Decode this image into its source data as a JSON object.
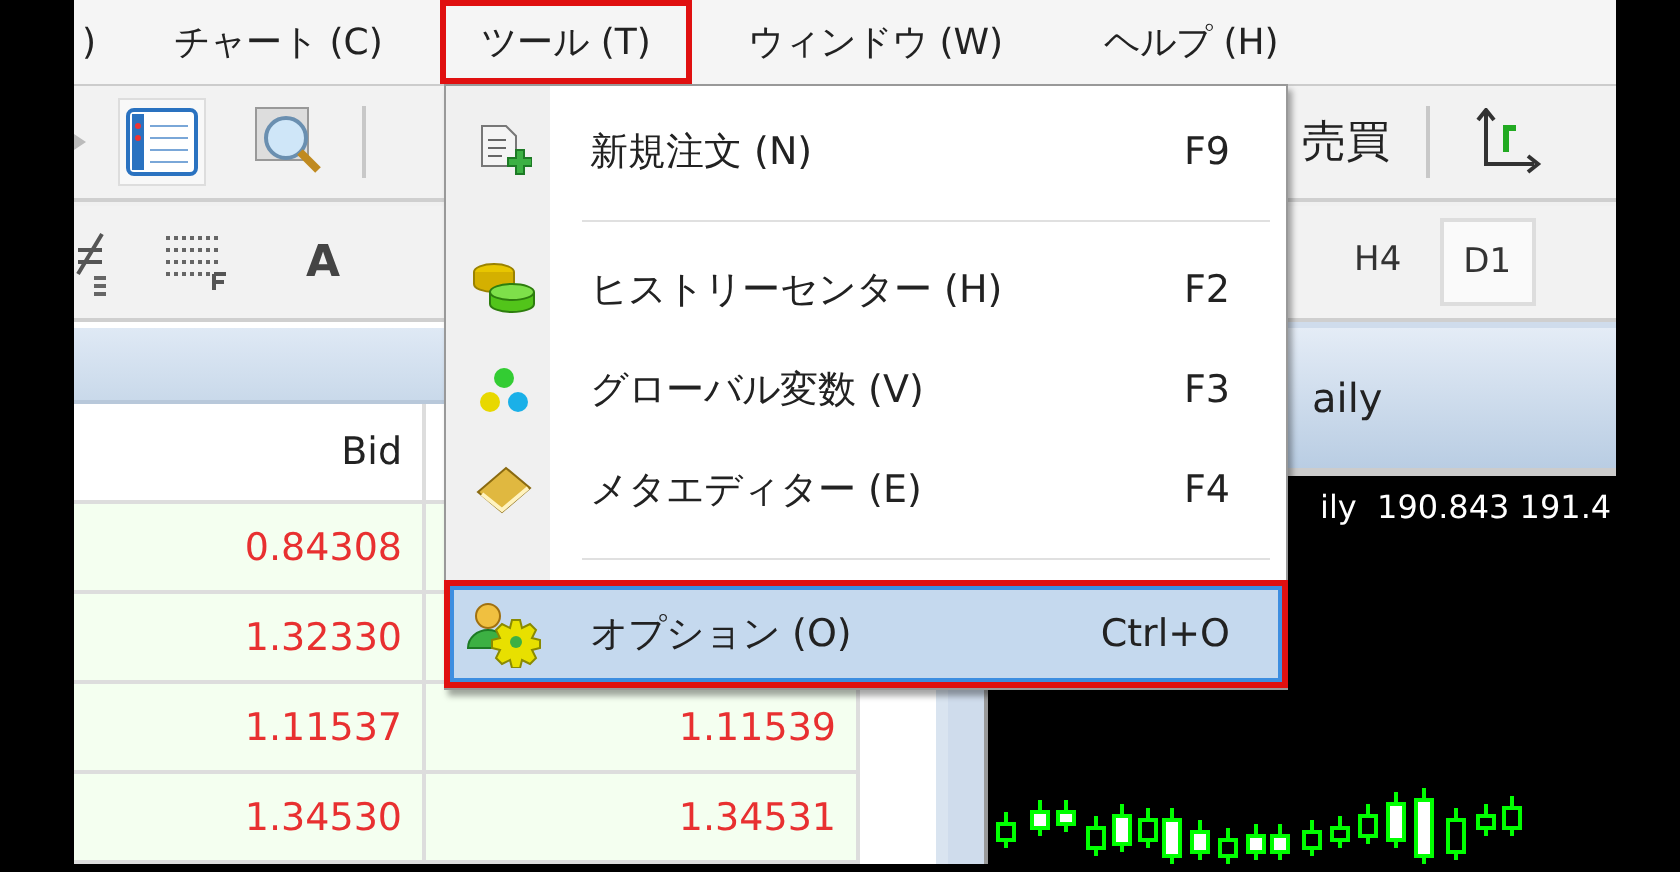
{
  "menu_bar": [
    {
      "label": ")",
      "marked": false
    },
    {
      "label": "チャート (C)",
      "marked": false
    },
    {
      "label": "ツール (T)",
      "marked": true
    },
    {
      "label": "ウィンドウ (W)",
      "marked": false
    },
    {
      "label": "ヘルプ (H)",
      "marked": false
    }
  ],
  "toolbar": {
    "trade_label": "売買",
    "font_button": "A",
    "timeframes": [
      {
        "label": "H4",
        "selected": false
      },
      {
        "label": "D1",
        "selected": true
      }
    ]
  },
  "dropdown": {
    "items": [
      {
        "kind": "item",
        "label": "新規注文 (N)",
        "shortcut": "F9",
        "selected": false,
        "marked": false
      },
      {
        "kind": "separator"
      },
      {
        "kind": "item",
        "label": "ヒストリーセンター (H)",
        "shortcut": "F2",
        "selected": false,
        "marked": false
      },
      {
        "kind": "item",
        "label": "グローバル変数 (V)",
        "shortcut": "F3",
        "selected": false,
        "marked": false
      },
      {
        "kind": "item",
        "label": "メタエディター (E)",
        "shortcut": "F4",
        "selected": false,
        "marked": false
      },
      {
        "kind": "separator"
      },
      {
        "kind": "item",
        "label": "オプション (O)",
        "shortcut": "Ctrl+O",
        "selected": true,
        "marked": true
      }
    ]
  },
  "quotes": {
    "columns": [
      "Bid"
    ],
    "rows": [
      {
        "bid": "0.84308"
      },
      {
        "bid": "1.32330"
      },
      {
        "bid": "1.11537",
        "ask": "1.11539"
      },
      {
        "bid": "1.34530",
        "ask": "1.34531"
      }
    ]
  },
  "chart": {
    "title": "aily",
    "info": "ily  190.843 191.4"
  }
}
